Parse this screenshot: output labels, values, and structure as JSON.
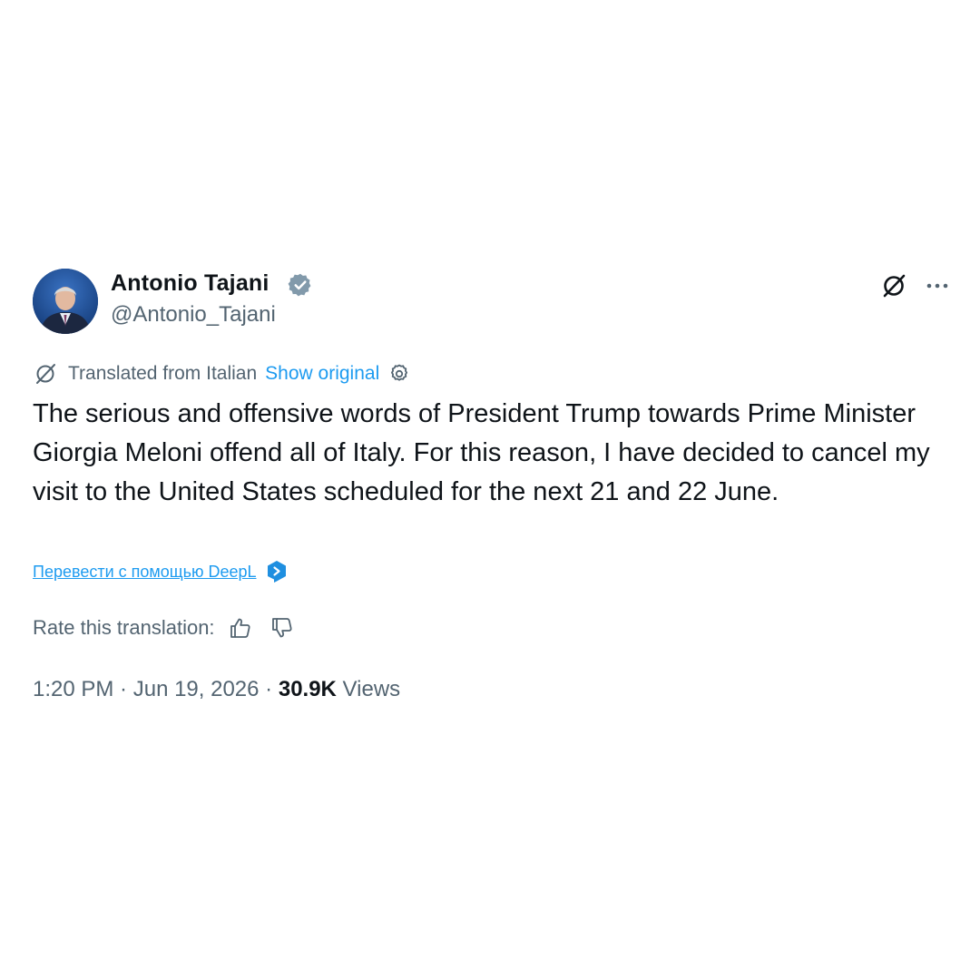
{
  "author": {
    "name": "Antonio Tajani",
    "handle": "@Antonio_Tajani"
  },
  "actions": {
    "grok_icon": "grok-icon",
    "more_icon": "more-icon"
  },
  "translation": {
    "label": "Translated from Italian",
    "show_original": "Show original"
  },
  "tweet": {
    "text": "The serious and offensive words of President Trump towards Prime Minister Giorgia Meloni offend all of Italy. For this reason, I have decided to cancel my visit to the United States scheduled for the next 21 and 22 June."
  },
  "deepl": {
    "link_text": "Перевести с помощью DeepL"
  },
  "rating": {
    "label": "Rate this translation:"
  },
  "meta": {
    "time": "1:20 PM",
    "separator": " · ",
    "date": "Jun 19, 2026",
    "views_count": "30.9K",
    "views_label": " Views"
  },
  "colors": {
    "text_primary": "#0f1419",
    "text_secondary": "#536471",
    "link": "#1d9bf0",
    "verified_badge": "#829aab"
  }
}
